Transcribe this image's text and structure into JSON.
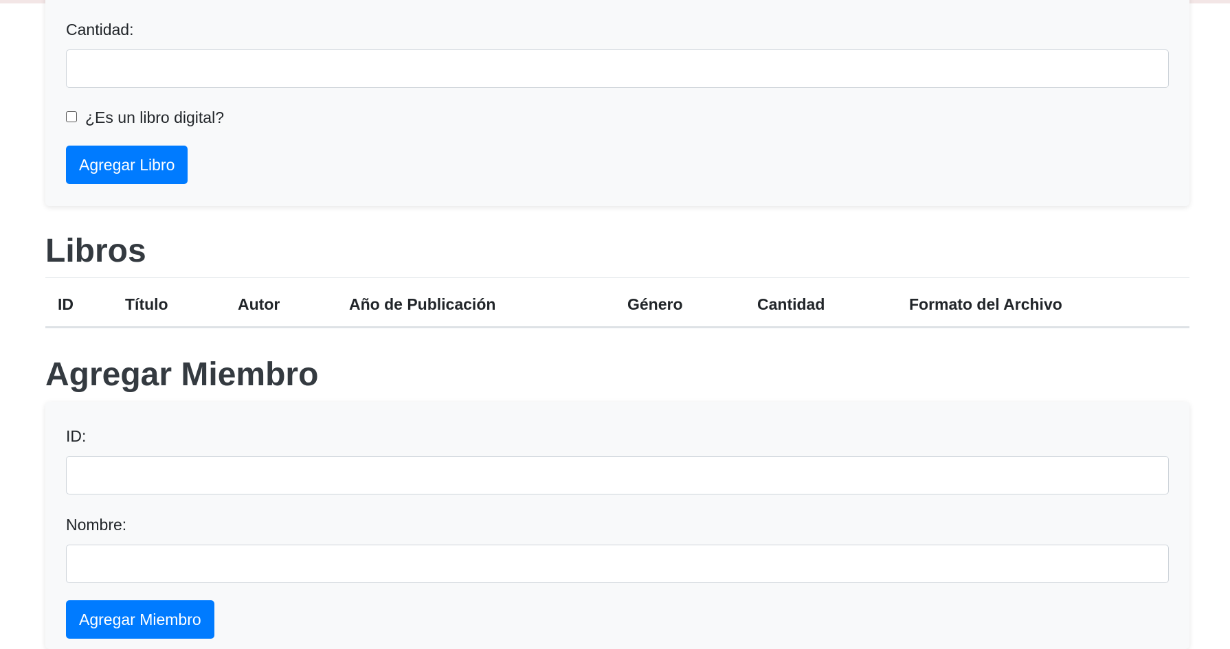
{
  "book_form": {
    "quantity_label": "Cantidad:",
    "quantity_value": "",
    "digital_checkbox_label": "¿Es un libro digital?",
    "digital_checked": false,
    "submit_label": "Agregar Libro"
  },
  "books_section": {
    "title": "Libros",
    "columns": [
      "ID",
      "Título",
      "Autor",
      "Año de Publicación",
      "Género",
      "Cantidad",
      "Formato del Archivo"
    ],
    "rows": []
  },
  "member_section": {
    "title": "Agregar Miembro",
    "id_label": "ID:",
    "id_value": "",
    "name_label": "Nombre:",
    "name_value": "",
    "submit_label": "Agregar Miembro"
  },
  "colors": {
    "primary": "#007bff",
    "card_background": "#f8f9fa",
    "heading": "#343a40"
  }
}
